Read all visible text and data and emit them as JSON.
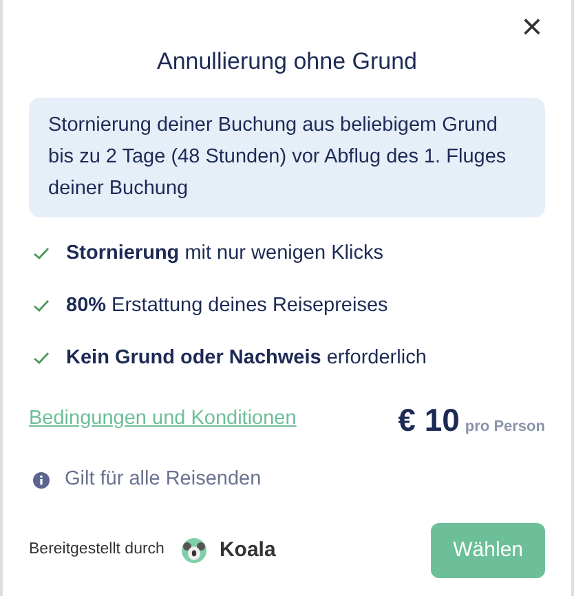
{
  "dialog": {
    "title": "Annullierung ohne Grund",
    "close": "×"
  },
  "summary": "Stornierung deiner Buchung aus beliebigem Grund bis zu 2 Tage (48 Stunden) vor Abflug des 1. Fluges deiner Buchung",
  "features": [
    {
      "text": "**Stornierung** mit nur wenigen Klicks"
    },
    {
      "text": "**80%** Erstattung deines Reisepreises"
    },
    {
      "text": "**Kein Grund oder Nachweis** erforderlich"
    }
  ],
  "terms_link": "Bedingungen und Konditionen",
  "price": {
    "amount": "€ 10",
    "unit": "pro Person"
  },
  "info": "Gilt für alle Reisenden",
  "footer": {
    "provided_by": "Bereitgestellt durch",
    "provider": "Koala",
    "button": "Wählen"
  }
}
